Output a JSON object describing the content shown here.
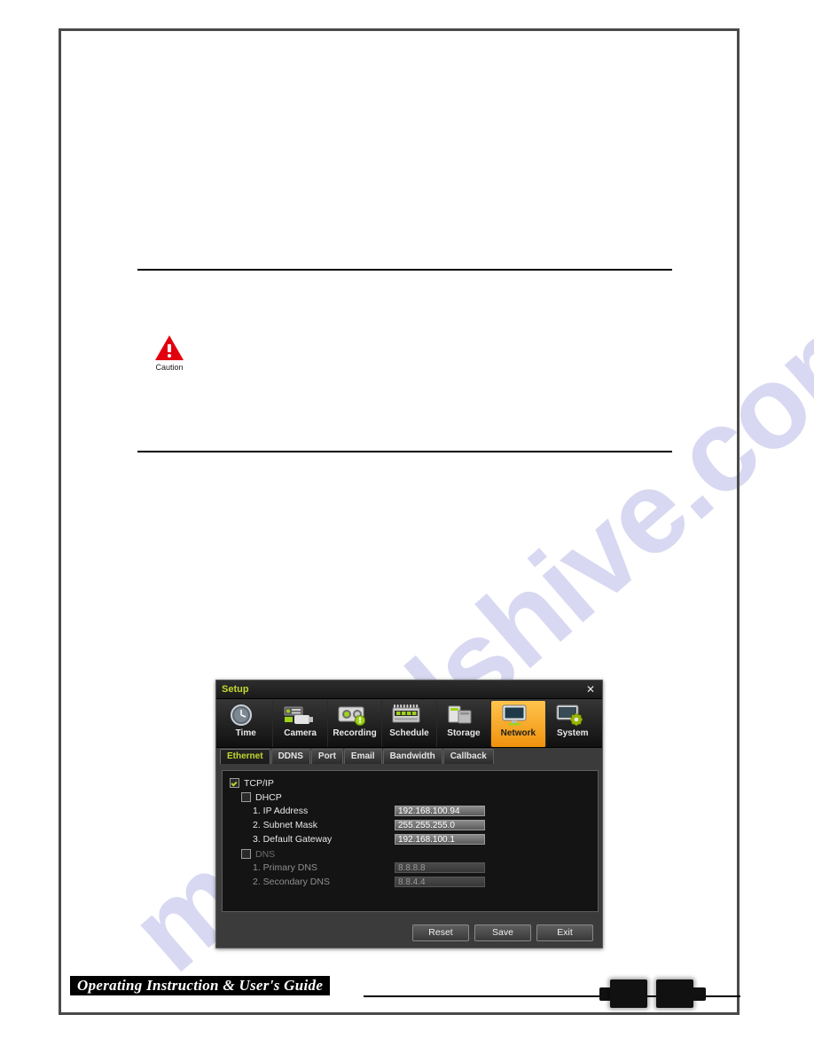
{
  "document": {
    "watermark_text": "manualshive.com",
    "footer_title": "Operating Instruction & User's Guide",
    "caution_label": "Caution"
  },
  "dialog": {
    "title": "Setup",
    "close_icon": "✕",
    "toolbar": [
      {
        "label": "Time",
        "icon": "clock-icon",
        "active": false
      },
      {
        "label": "Camera",
        "icon": "camera-icon",
        "active": false
      },
      {
        "label": "Recording",
        "icon": "recording-icon",
        "active": false
      },
      {
        "label": "Schedule",
        "icon": "calendar-icon",
        "active": false
      },
      {
        "label": "Storage",
        "icon": "storage-icon",
        "active": false
      },
      {
        "label": "Network",
        "icon": "monitor-icon",
        "active": true
      },
      {
        "label": "System",
        "icon": "system-icon",
        "active": false
      }
    ],
    "tabs": [
      {
        "label": "Ethernet",
        "active": true
      },
      {
        "label": "DDNS",
        "active": false
      },
      {
        "label": "Port",
        "active": false
      },
      {
        "label": "Email",
        "active": false
      },
      {
        "label": "Bandwidth",
        "active": false
      },
      {
        "label": "Callback",
        "active": false
      }
    ],
    "form": {
      "tcpip": {
        "label": "TCP/IP",
        "checked": true
      },
      "dhcp": {
        "label": "DHCP",
        "checked": false
      },
      "dns": {
        "label": "DNS",
        "checked": false
      },
      "network_fields": [
        {
          "label": "1. IP Address",
          "value": "192.168.100.94"
        },
        {
          "label": "2. Subnet Mask",
          "value": "255.255.255.0"
        },
        {
          "label": "3. Default Gateway",
          "value": "192.168.100.1"
        }
      ],
      "dns_fields": [
        {
          "label": "1. Primary DNS",
          "value": "8.8.8.8"
        },
        {
          "label": "2. Secondary DNS",
          "value": "8.8.4.4"
        }
      ]
    },
    "buttons": [
      {
        "label": "Reset"
      },
      {
        "label": "Save"
      },
      {
        "label": "Exit"
      }
    ]
  },
  "colors": {
    "accent_active": "#f0920c",
    "title_green": "#c3d82e",
    "caution_red": "#e2000f",
    "watermark": "#d8d8f2"
  }
}
